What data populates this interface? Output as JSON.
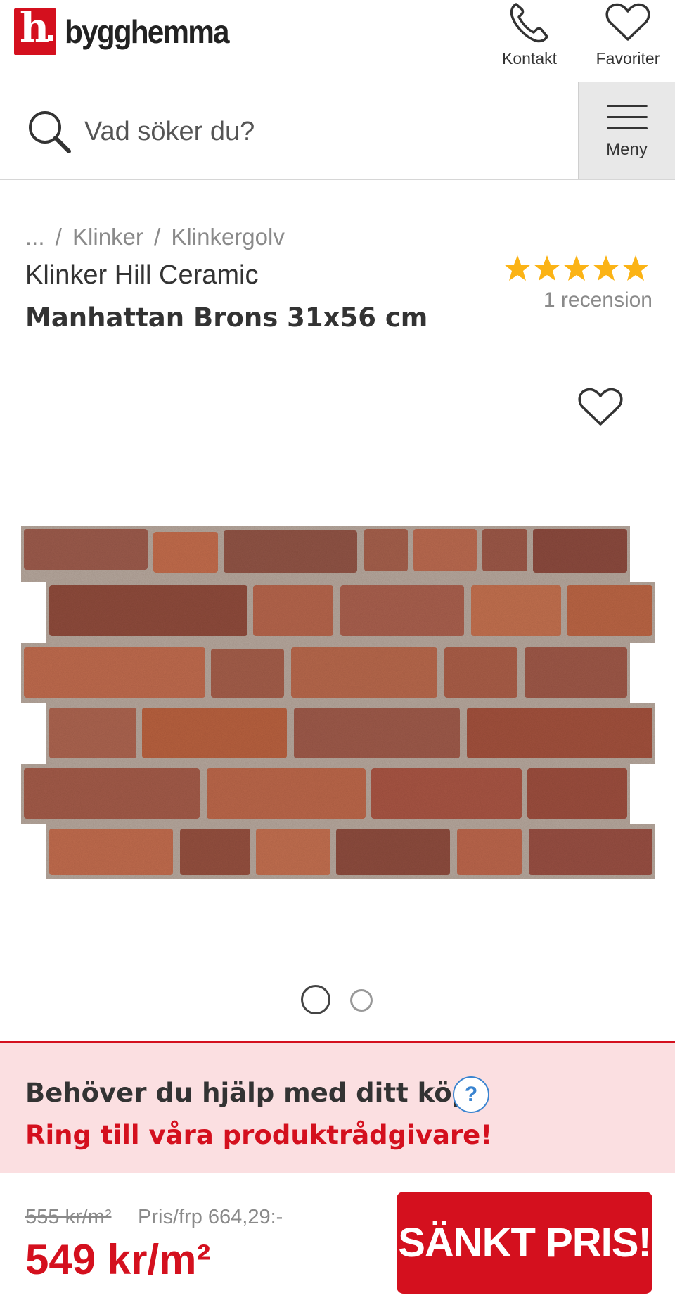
{
  "header": {
    "logo_letter": "h",
    "logo_text": "bygghemma",
    "contact_label": "Kontakt",
    "favorites_label": "Favoriter"
  },
  "search": {
    "placeholder": "Vad söker du?",
    "menu_label": "Meny"
  },
  "breadcrumb": [
    "...",
    "/",
    "Klinker",
    "/",
    "Klinkergolv"
  ],
  "product": {
    "brand": "Klinker Hill Ceramic",
    "name": "Manhattan Brons 31x56 cm",
    "rating": 5,
    "rating_max": 5,
    "review_count_text": "1 recension",
    "image_count": 2,
    "active_image": 1
  },
  "help": {
    "question": "Behöver du hjälp med ditt köp?",
    "icon": "?",
    "cta": "Ring till våra produktrådgivare!"
  },
  "price": {
    "old": "555 kr/m²",
    "per_pack": "Pris/frp 664,29:-",
    "current": "549 kr/m²",
    "button_label": "SÄNKT PRIS!"
  },
  "colors": {
    "brand_red": "#d4101e",
    "star": "#fbb315",
    "help_bg": "#fbdfe1",
    "help_icon": "#3a84d0"
  },
  "icons": [
    "phone-icon",
    "heart-icon",
    "search-icon",
    "hamburger-icon",
    "star-icon",
    "help-icon"
  ]
}
